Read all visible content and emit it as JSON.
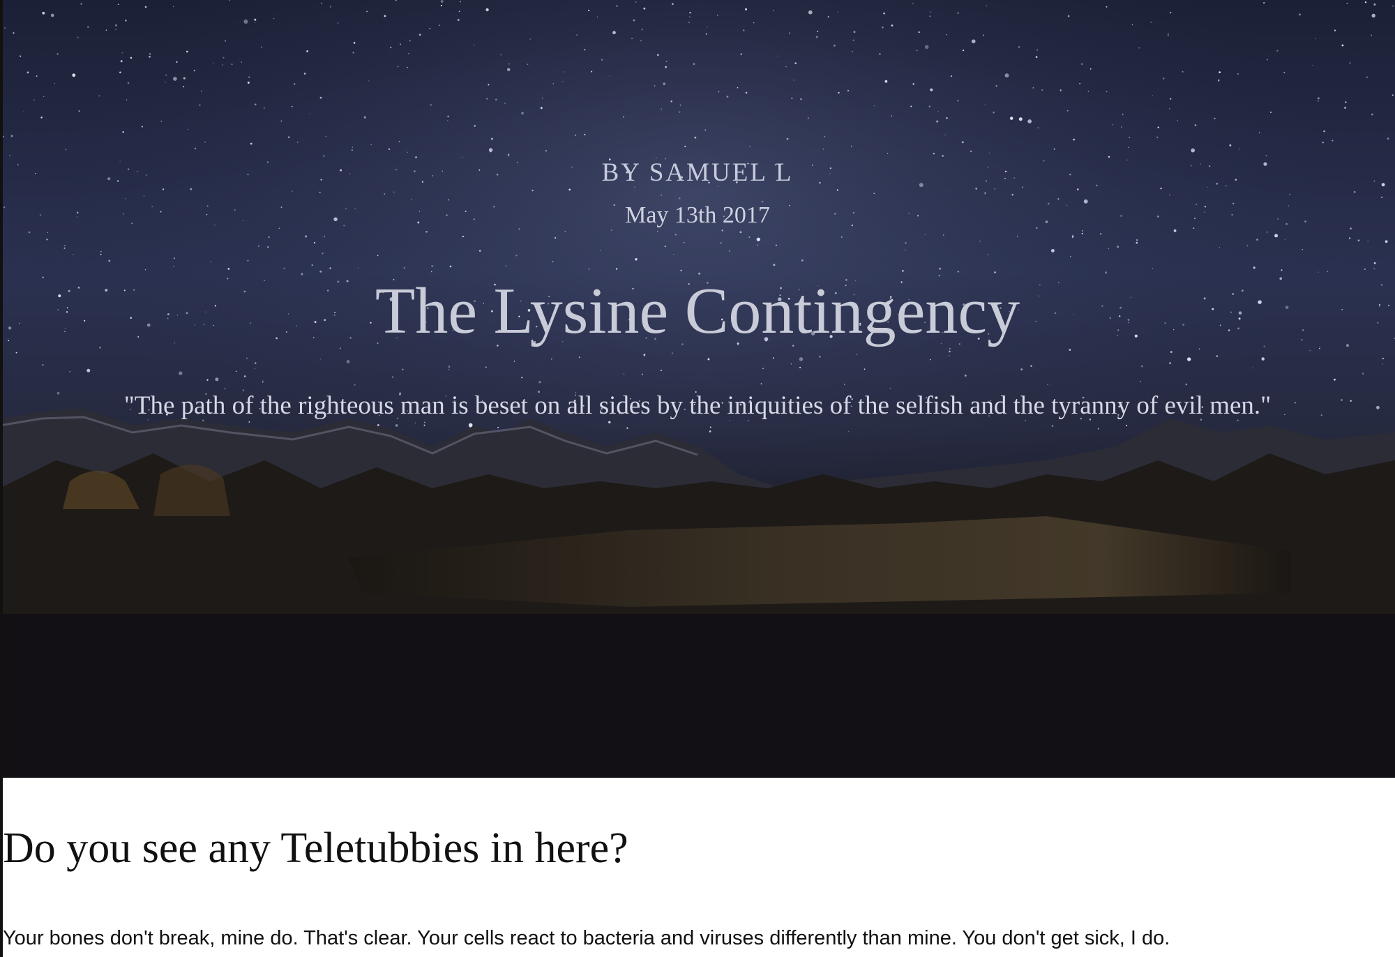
{
  "hero": {
    "byline": "BY SAMUEL L",
    "date": "May 13th 2017",
    "title": "The Lysine Contingency",
    "quote": "\"The path of the righteous man is beset on all sides by the iniquities of the selfish and the tyranny of evil men.\""
  },
  "article": {
    "heading": "Do you see any Teletubbies in here?",
    "body": "Your bones don't break, mine do. That's clear. Your cells react to bacteria and viruses differently than mine. You don't get sick, I do."
  },
  "colors": {
    "sky_top": "#1e2238",
    "sky_mid": "#2c3454",
    "ground": "#14110f",
    "hero_text": "#d6d8e6",
    "body_text": "#111111",
    "page_background": "#ffffff"
  }
}
